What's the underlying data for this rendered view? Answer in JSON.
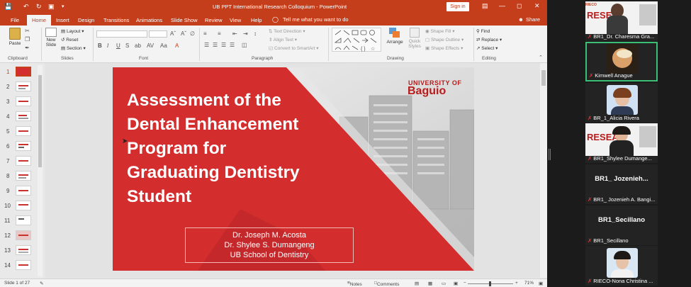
{
  "window": {
    "title": "UB PPT International Research Colloquium  -  PowerPoint",
    "sign_in": "Sign in"
  },
  "tabs": [
    "File",
    "Home",
    "Insert",
    "Design",
    "Transitions",
    "Animations",
    "Slide Show",
    "Review",
    "View",
    "Help"
  ],
  "tell_me": "Tell me what you want to do",
  "share": "Share",
  "ribbon": {
    "clipboard": {
      "paste": "Paste",
      "label": "Clipboard"
    },
    "slides": {
      "new_slide": "New",
      "new_slide2": "Slide",
      "layout": "Layout",
      "reset": "Reset",
      "section": "Section",
      "label": "Slides"
    },
    "font": {
      "label": "Font",
      "bold": "B",
      "italic": "I",
      "underline": "U",
      "strike": "S"
    },
    "paragraph": {
      "label": "Paragraph",
      "text_direction": "Text Direction",
      "align_text": "Align Text",
      "smartart": "Convert to SmartArt"
    },
    "drawing": {
      "label": "Drawing",
      "arrange": "Arrange",
      "quick_styles": "Quick",
      "quick_styles2": "Styles",
      "shape_fill": "Shape Fill",
      "shape_outline": "Shape Outline",
      "shape_effects": "Shape Effects"
    },
    "editing": {
      "label": "Editing",
      "find": "Find",
      "replace": "Replace",
      "select": "Select"
    }
  },
  "thumbnails": [
    "1",
    "2",
    "3",
    "4",
    "5",
    "6",
    "7",
    "8",
    "9",
    "10",
    "11",
    "12",
    "13",
    "14"
  ],
  "slide": {
    "title_lines": [
      "Assessment of the",
      "Dental Enhancement",
      "Program for",
      "Graduating Dentistry",
      "Student"
    ],
    "authors": [
      "Dr. Joseph M. Acosta",
      "Dr. Shylee S. Dumangeng",
      "UB School of Dentistry"
    ],
    "logo_top": "UNIVERSITY OF",
    "logo_main": "Baguio"
  },
  "status": {
    "slide_count": "Slide 1 of 27",
    "notes": "Notes",
    "comments": "Comments",
    "zoom": "71%"
  },
  "participants": [
    {
      "name": "BR1_Dr. Charesma Gra...",
      "muted": true
    },
    {
      "name": "Kimwell Anague",
      "muted": true,
      "speaking": true
    },
    {
      "name": "BR_1_Alicia Rivera",
      "muted": true
    },
    {
      "name": "BR1_Shylee Dumange...",
      "muted": true
    },
    {
      "display": "BR1_ Jozenieh...",
      "name": "BR1_ Jozenieh A. Bangi...",
      "muted": true
    },
    {
      "display": "BR1_Secillano",
      "name": "BR1_Secillano",
      "muted": true
    },
    {
      "name": "RIECO-Nona Christina ...",
      "muted": true
    }
  ],
  "colors": {
    "ppt_red": "#c43e1c",
    "slide_red": "#d32d2d",
    "active_speaker": "#3bbf77"
  }
}
